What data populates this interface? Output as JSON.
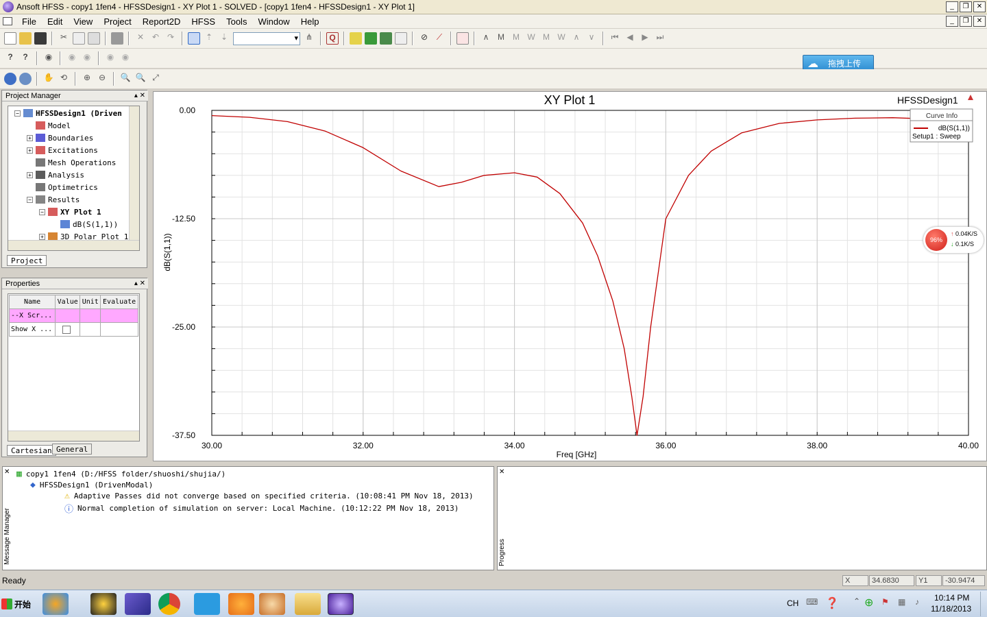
{
  "window": {
    "title": "Ansoft HFSS  - copy1 1fen4 - HFSSDesign1 - XY Plot 1 - SOLVED - [copy1 1fen4 - HFSSDesign1 - XY Plot 1]"
  },
  "menubar": {
    "items": [
      "File",
      "Edit",
      "View",
      "Project",
      "Report2D",
      "HFSS",
      "Tools",
      "Window",
      "Help"
    ]
  },
  "upload_button": {
    "label": "拖拽上传"
  },
  "project_manager": {
    "header": "Project Manager",
    "tab": "Project",
    "tree": [
      {
        "label": "HFSSDesign1 (Driven",
        "level": 1,
        "toggle": "−",
        "bold": true
      },
      {
        "label": "Model",
        "level": 2,
        "toggle": ""
      },
      {
        "label": "Boundaries",
        "level": 2,
        "toggle": "+"
      },
      {
        "label": "Excitations",
        "level": 2,
        "toggle": "+"
      },
      {
        "label": "Mesh Operations",
        "level": 2,
        "toggle": ""
      },
      {
        "label": "Analysis",
        "level": 2,
        "toggle": "+"
      },
      {
        "label": "Optimetrics",
        "level": 2,
        "toggle": ""
      },
      {
        "label": "Results",
        "level": 2,
        "toggle": "−"
      },
      {
        "label": "XY Plot 1",
        "level": 3,
        "toggle": "−",
        "bold": true
      },
      {
        "label": "dB(S(1,1))",
        "level": 4,
        "toggle": ""
      },
      {
        "label": "3D Polar Plot 1",
        "level": 3,
        "toggle": "+"
      }
    ]
  },
  "properties": {
    "header": "Properties",
    "columns": [
      "Name",
      "Value",
      "Unit",
      "Evaluate"
    ],
    "rows": [
      {
        "name": "--X Scr...",
        "value": "",
        "unit": "",
        "evaluate": ""
      },
      {
        "name": "Show X ...",
        "value": "",
        "unit": "",
        "evaluate": ""
      }
    ],
    "tabs": [
      "Cartesian",
      "General"
    ]
  },
  "plot": {
    "design_label": "HFSSDesign1",
    "curve_info": {
      "header": "Curve Info",
      "curve": "dB(S(1,1))",
      "setup": "Setup1 : Sweep"
    }
  },
  "chart_data": {
    "type": "line",
    "title": "XY Plot 1",
    "xlabel": "Freq [GHz]",
    "ylabel": "dB(S(1,1))",
    "xlim": [
      30,
      40
    ],
    "ylim": [
      -37.5,
      0
    ],
    "x_ticks": [
      "30.00",
      "32.00",
      "34.00",
      "36.00",
      "38.00",
      "40.00"
    ],
    "y_ticks": [
      "0.00",
      "-12.50",
      "-25.00",
      "-37.50"
    ],
    "grid": true,
    "line_color": "#c00000",
    "series": [
      {
        "name": "dB(S(1,1))",
        "x": [
          30.0,
          30.5,
          31.0,
          31.5,
          32.0,
          32.5,
          33.0,
          33.3,
          33.6,
          34.0,
          34.3,
          34.6,
          34.9,
          35.1,
          35.3,
          35.45,
          35.55,
          35.62,
          35.7,
          35.8,
          36.0,
          36.3,
          36.6,
          37.0,
          37.5,
          38.0,
          38.5,
          39.0,
          39.5,
          40.0
        ],
        "y": [
          -0.6,
          -0.8,
          -1.3,
          -2.4,
          -4.3,
          -7.0,
          -8.8,
          -8.3,
          -7.5,
          -7.2,
          -7.7,
          -9.6,
          -13.0,
          -16.8,
          -22.0,
          -27.5,
          -33.0,
          -37.5,
          -33.0,
          -25.0,
          -12.5,
          -7.5,
          -4.7,
          -2.6,
          -1.5,
          -1.1,
          -0.9,
          -0.85,
          -1.0,
          -1.1
        ]
      }
    ]
  },
  "speed_widget": {
    "percent": "96%",
    "up": "0.04K/S",
    "down": "0.1K/S"
  },
  "message_manager": {
    "label": "Message Manager",
    "lines": [
      {
        "text": "copy1 1fen4 (D:/HFSS folder/shuoshi/shujia/)",
        "indent": 0,
        "icon": "project"
      },
      {
        "text": "HFSSDesign1 (DrivenModal)",
        "indent": 1,
        "icon": "design"
      },
      {
        "text": "Adaptive Passes did not converge based on specified criteria.  (10:08:41 PM  Nov 18, 2013)",
        "indent": 2,
        "icon": "warning"
      },
      {
        "text": "Normal completion of simulation on server: Local Machine.  (10:12:22 PM  Nov 18, 2013)",
        "indent": 2,
        "icon": "info"
      }
    ]
  },
  "progress": {
    "label": "Progress"
  },
  "status": {
    "text": "Ready",
    "x_label": "X",
    "x_value": "34.6830",
    "y_label": "Y1",
    "y_value": "-30.9474"
  },
  "taskbar": {
    "start": "开始",
    "lang": "CH",
    "time": "10:14 PM",
    "date": "11/18/2013"
  }
}
